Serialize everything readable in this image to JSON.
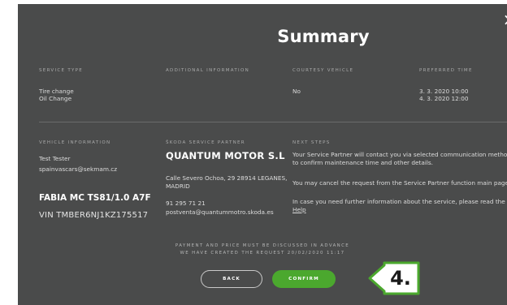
{
  "modal": {
    "title": "Summary",
    "close_icon": "close-icon"
  },
  "sections": {
    "service_type": {
      "label": "SERVICE TYPE",
      "items": [
        "Tire change",
        "Oil Change"
      ]
    },
    "additional_information": {
      "label": "ADDITIONAL INFORMATION",
      "value": ""
    },
    "courtesy_vehicle": {
      "label": "COURTESY VEHICLE",
      "value": "No"
    },
    "preferred_time": {
      "label": "PREFERRED TIME",
      "items": [
        "3. 3. 2020 10:00",
        "4. 3. 2020 12:00"
      ]
    },
    "vehicle_information": {
      "label": "VEHICLE INFORMATION",
      "name": "Test Tester",
      "email": "spainvascars@sekmam.cz",
      "model": "FABIA MC TS81/1.0 A7F",
      "vin": "VIN TMBER6NJ1KZ175517"
    },
    "service_partner": {
      "label": "ŠKODA SERVICE PARTNER",
      "name": "QUANTUM MOTOR S.L",
      "address_line1": "Calle Severo Ochoa, 29 28914 LEGANES,",
      "address_line2": "MADRID",
      "phone": "91 295 71 21",
      "email": "postventa@quantummotro.skoda.es"
    },
    "next_steps": {
      "label": "NEXT STEPS",
      "step1_line1": "Your Service Partner will contact you via selected communication method",
      "step1_line2": "to confirm maintenance time and other details.",
      "step2": "You may cancel the request from the Service Partner function main page",
      "step3_line1": "In case you need further information about the service, please read the",
      "help_link": "Help"
    }
  },
  "notice": {
    "line1": "PAYMENT AND PRICE MUST BE DISCUSSED IN ADVANCE",
    "line2": "WE HAVE CREATED THE REQUEST 20/02/2020 11:17"
  },
  "buttons": {
    "back": "BACK",
    "confirm": "CONFIRM"
  },
  "callout": {
    "label": "4."
  },
  "colors": {
    "panel_bg": "#4a4b4b",
    "confirm_green": "#4ba82e",
    "callout_green": "#4ba82e",
    "text_white": "#ffffff",
    "label_gray": "#a9aaaa"
  }
}
